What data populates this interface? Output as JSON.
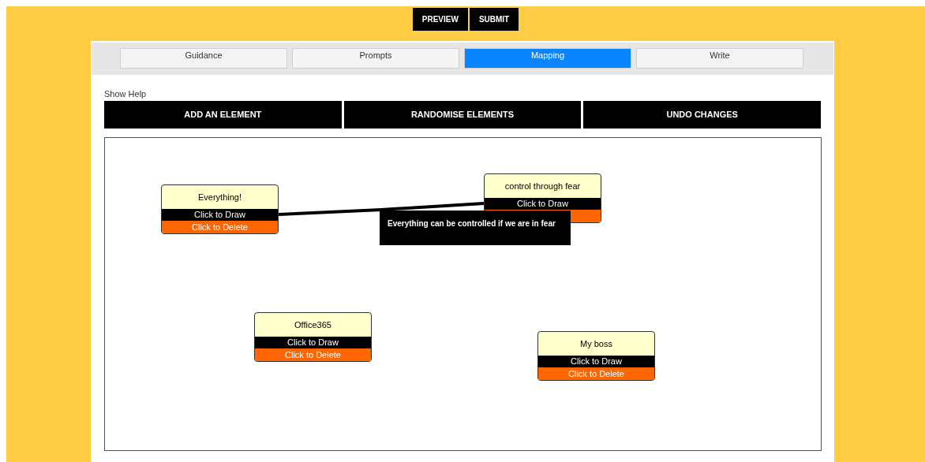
{
  "top_buttons": [
    "PREVIEW",
    "SUBMIT"
  ],
  "tabs": [
    {
      "label": "Guidance",
      "selected": false
    },
    {
      "label": "Prompts",
      "selected": false
    },
    {
      "label": "Mapping",
      "selected": true
    },
    {
      "label": "Write",
      "selected": false
    }
  ],
  "show_help": "Show Help",
  "actions": [
    "ADD AN ELEMENT",
    "RANDOMISE ELEMENTS",
    "UNDO CHANGES"
  ],
  "nodes": [
    {
      "label": "Everything!",
      "draw_label": "Click to Draw",
      "delete_label": "Click to Delete"
    },
    {
      "label": "control through fear",
      "draw_label": "Click to Draw"
    },
    {
      "label": "Office365",
      "draw_label": "Click to Draw",
      "delete_label": "Click to Delete"
    },
    {
      "label": "My boss",
      "draw_label": "Click to Draw",
      "delete_label": "Click to Delete"
    }
  ],
  "tooltip": {
    "text": "Everything can be controlled if we are in fear"
  }
}
